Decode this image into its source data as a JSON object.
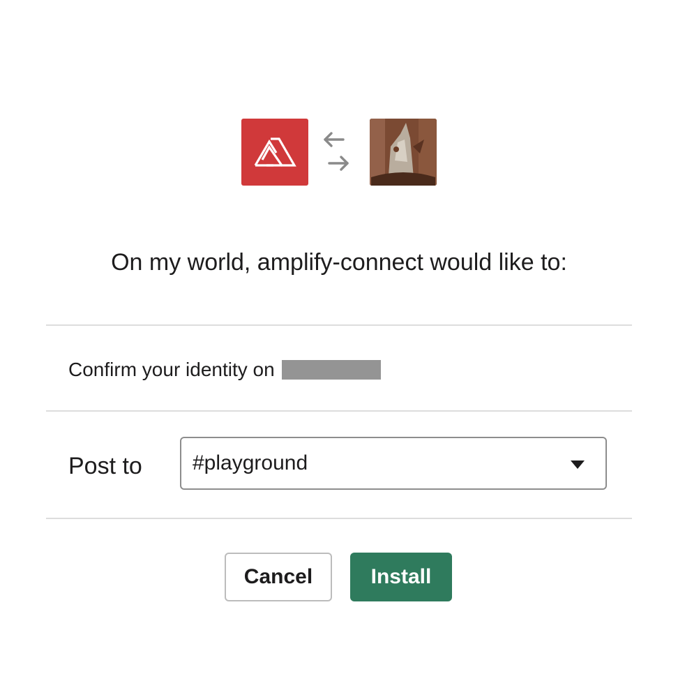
{
  "icons": {
    "app_logo": "amplify-logo-icon",
    "exchange": "exchange-arrows-icon",
    "workspace": "workspace-avatar"
  },
  "colors": {
    "app_logo_bg": "#d0393a",
    "install_button": "#2f7b5d",
    "redaction": "#949494"
  },
  "heading": "On my world, amplify-connect would like to:",
  "permissions": [
    {
      "label": "Confirm your identity on"
    }
  ],
  "post_to": {
    "label": "Post to",
    "selected_channel": "#playground"
  },
  "buttons": {
    "cancel": "Cancel",
    "install": "Install"
  }
}
